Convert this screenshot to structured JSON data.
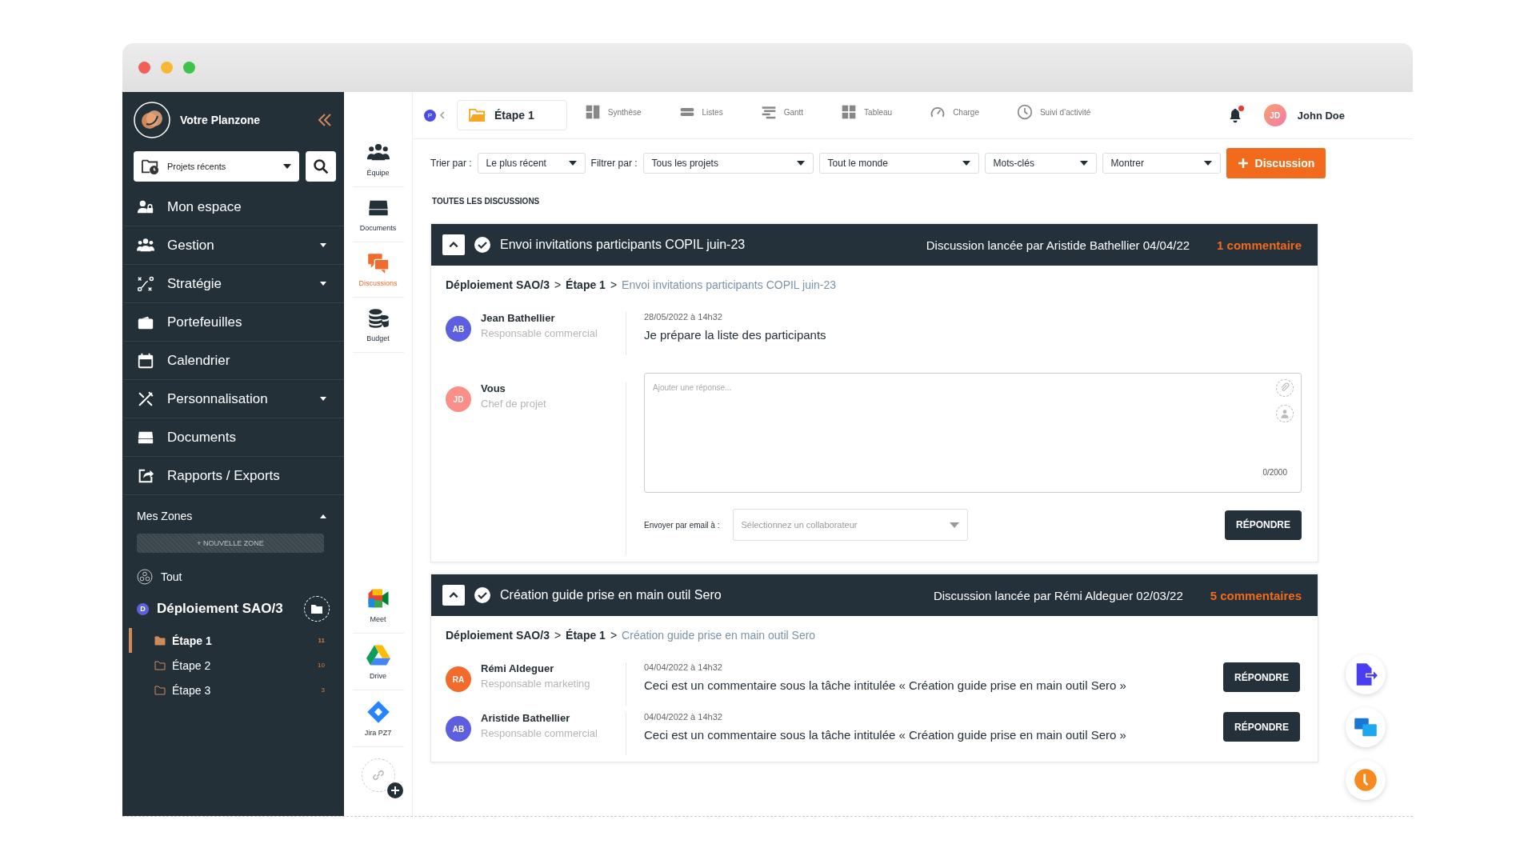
{
  "sidebar": {
    "brand": "Votre Planzone",
    "recent": "Projets récents",
    "nav": [
      {
        "kind": "user-lock",
        "label": "Mon espace",
        "has_caret": false
      },
      {
        "kind": "users-gear",
        "label": "Gestion",
        "has_caret": true
      },
      {
        "kind": "strategy",
        "label": "Stratégie",
        "has_caret": true
      },
      {
        "kind": "wallet",
        "label": "Portefeuilles",
        "has_caret": false
      },
      {
        "kind": "calendar",
        "label": "Calendrier",
        "has_caret": false
      },
      {
        "kind": "tools",
        "label": "Personnalisation",
        "has_caret": true
      },
      {
        "kind": "drive",
        "label": "Documents",
        "has_caret": false
      },
      {
        "kind": "share",
        "label": "Rapports / Exports",
        "has_caret": false
      }
    ],
    "zones_title": "Mes Zones",
    "zones_expanded": true,
    "new_zone": "+ NOUVELLE ZONE",
    "all": "Tout",
    "project": {
      "badge": "D",
      "name": "Déploiement SAO/3",
      "children": [
        {
          "label": "Étape 1",
          "count": "11",
          "selected": true
        },
        {
          "label": "Étape 2",
          "count": "10",
          "selected": false
        },
        {
          "label": "Étape 3",
          "count": "3",
          "selected": false
        }
      ]
    }
  },
  "rail": {
    "items": [
      {
        "kind": "team",
        "label": "Équipe",
        "selected": false
      },
      {
        "kind": "drive",
        "label": "Documents",
        "selected": false
      },
      {
        "kind": "chat",
        "label": "Discussions",
        "selected": true
      },
      {
        "kind": "coins",
        "label": "Budget",
        "selected": false
      }
    ],
    "integrations": [
      {
        "kind": "meet",
        "label": "Meet"
      },
      {
        "kind": "gdrive",
        "label": "Drive"
      },
      {
        "kind": "jira",
        "label": "Jira PZ7"
      }
    ]
  },
  "topbar": {
    "badge": "P",
    "current": "Étape 1",
    "views": [
      {
        "kind": "synthese",
        "label": "Synthèse"
      },
      {
        "kind": "lists",
        "label": "Listes"
      },
      {
        "kind": "gantt",
        "label": "Gantt"
      },
      {
        "kind": "grid",
        "label": "Tableau"
      },
      {
        "kind": "gauge",
        "label": "Charge"
      },
      {
        "kind": "clock",
        "label": "Suivi d’activité"
      }
    ],
    "unread": true,
    "user": {
      "initials": "JD",
      "name": "John Doe"
    }
  },
  "filters": {
    "sort_label": "Trier par :",
    "sort": "Le plus récent",
    "filter_label": "Filtrer par :",
    "selects": [
      "Tous les projets",
      "Tout le monde",
      "Mots-clés",
      "Montrer"
    ],
    "new_button": "Discussion"
  },
  "section_title": "TOUTES LES DISCUSSIONS",
  "discussions": [
    {
      "title": "Envoi invitations participants COPIL juin-23",
      "started": "Discussion lancée par Aristide Bathellier 04/04/22",
      "comments": "1 commentaire",
      "expanded": true,
      "breadcrumb": [
        {
          "label": "Déploiement SAO/3",
          "sep": ">"
        },
        {
          "label": "Étape 1",
          "sep": ">"
        },
        {
          "label": "Envoi invitations participants COPIL juin-23"
        }
      ],
      "messages": [
        {
          "initials": "AB",
          "color": "#5b5fe0",
          "author": "Jean Bathellier",
          "role": "Responsable commercial",
          "date": "28/05/2022 à 14h32",
          "text": "Je prépare la liste des participants"
        }
      ],
      "composer": {
        "initials": "JD",
        "color": "#f98f86",
        "author": "Vous",
        "role": "Chef de projet",
        "placeholder": "Ajouter une réponse...",
        "counter": "0/2000",
        "email_label": "Envoyer par email à :",
        "select_placeholder": "Sélectionnez un collaborateur",
        "button": "RÉPONDRE"
      }
    },
    {
      "title": "Création guide prise en main outil Sero",
      "started": "Discussion lancée par Rémi Aldeguer 02/03/22",
      "comments": "5 commentaires",
      "expanded": true,
      "breadcrumb": [
        {
          "label": "Déploiement SAO/3",
          "sep": ">"
        },
        {
          "label": "Étape 1",
          "sep": ">"
        },
        {
          "label": "Création guide prise en main outil Sero"
        }
      ],
      "messages": [
        {
          "initials": "RA",
          "color": "#f26b2c",
          "author": "Rémi Aldeguer",
          "role": "Responsable marketing",
          "date": "04/04/2022 à 14h32",
          "text": "Ceci est un commentaire sous la tâche intitulée « Création guide prise en main outil Sero »",
          "button": "RÉPONDRE"
        },
        {
          "initials": "AB",
          "color": "#5b5fe0",
          "author": "Aristide Bathellier",
          "role": "Responsable commercial",
          "date": "04/04/2022 à 14h32",
          "text": "Ceci est un commentaire sous la tâche intitulée « Création guide prise en main outil Sero »",
          "button": "RÉPONDRE"
        }
      ]
    }
  ]
}
